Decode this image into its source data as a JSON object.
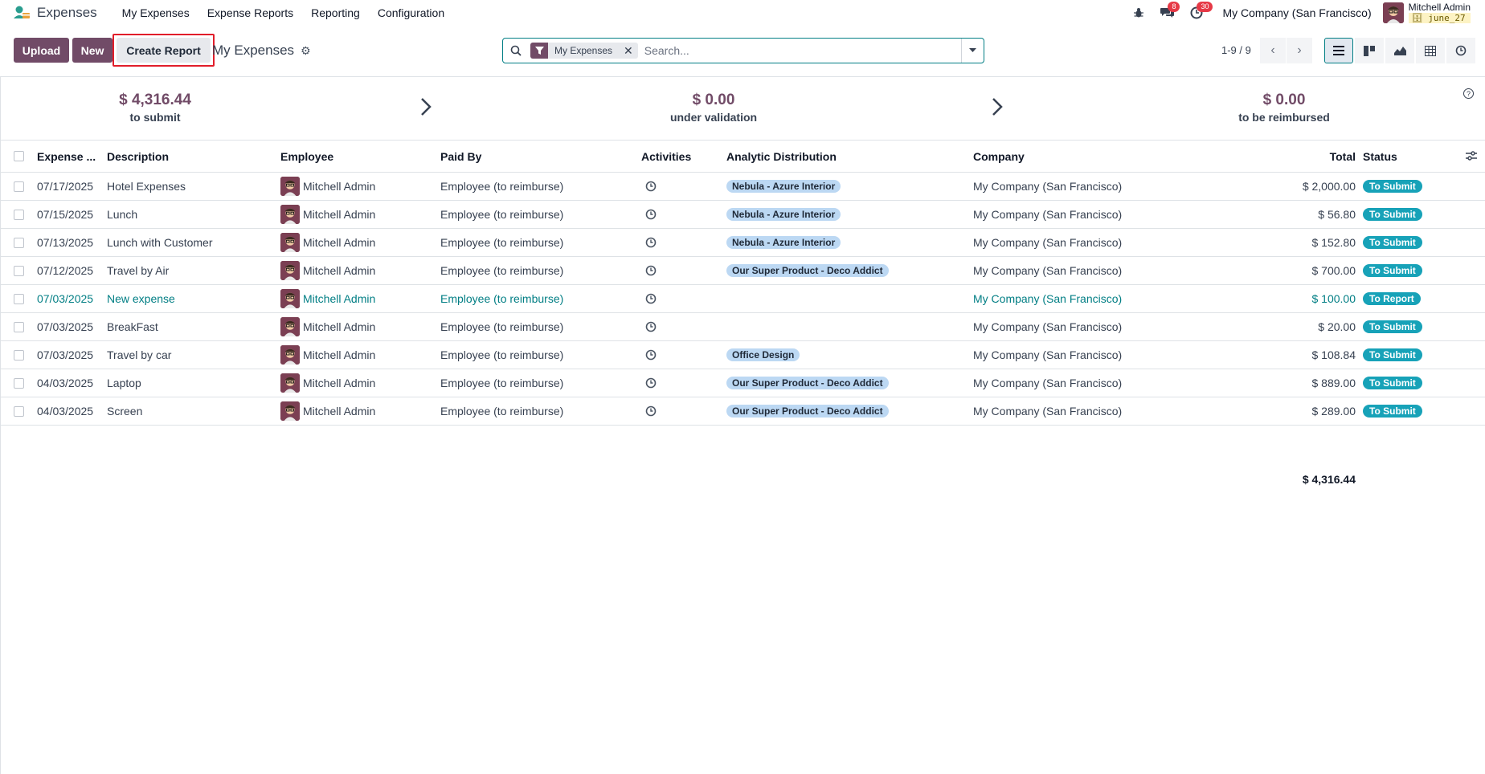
{
  "app": {
    "title": "Expenses",
    "menu": [
      "My Expenses",
      "Expense Reports",
      "Reporting",
      "Configuration"
    ],
    "company": "My Company (San Francisco)",
    "user": "Mitchell Admin",
    "database": "june_27",
    "messages_count": "8",
    "activities_count": "30"
  },
  "toolbar": {
    "upload_label": "Upload",
    "new_label": "New",
    "create_report_label": "Create Report",
    "breadcrumb": "My Expenses"
  },
  "search": {
    "facet": "My Expenses",
    "placeholder": "Search..."
  },
  "pager": {
    "range": "1-9 / 9"
  },
  "stages": [
    {
      "amount": "$ 4,316.44",
      "label": "to submit"
    },
    {
      "amount": "$ 0.00",
      "label": "under validation"
    },
    {
      "amount": "$ 0.00",
      "label": "to be reimbursed"
    }
  ],
  "table": {
    "headers": {
      "date": "Expense ...",
      "description": "Description",
      "employee": "Employee",
      "paid_by": "Paid By",
      "activities": "Activities",
      "analytic": "Analytic Distribution",
      "company": "Company",
      "total": "Total",
      "status": "Status"
    },
    "rows": [
      {
        "date": "07/17/2025",
        "description": "Hotel Expenses",
        "employee": "Mitchell Admin",
        "paid_by": "Employee (to reimburse)",
        "analytic": "Nebula - Azure Interior",
        "company": "My Company (San Francisco)",
        "total": "$ 2,000.00",
        "status": "To Submit"
      },
      {
        "date": "07/15/2025",
        "description": "Lunch",
        "employee": "Mitchell Admin",
        "paid_by": "Employee (to reimburse)",
        "analytic": "Nebula - Azure Interior",
        "company": "My Company (San Francisco)",
        "total": "$ 56.80",
        "status": "To Submit"
      },
      {
        "date": "07/13/2025",
        "description": "Lunch with Customer",
        "employee": "Mitchell Admin",
        "paid_by": "Employee (to reimburse)",
        "analytic": "Nebula - Azure Interior",
        "company": "My Company (San Francisco)",
        "total": "$ 152.80",
        "status": "To Submit"
      },
      {
        "date": "07/12/2025",
        "description": "Travel by Air",
        "employee": "Mitchell Admin",
        "paid_by": "Employee (to reimburse)",
        "analytic": "Our Super Product - Deco Addict",
        "company": "My Company (San Francisco)",
        "total": "$ 700.00",
        "status": "To Submit"
      },
      {
        "date": "07/03/2025",
        "description": "New expense",
        "employee": "Mitchell Admin",
        "paid_by": "Employee (to reimburse)",
        "analytic": "",
        "company": "My Company (San Francisco)",
        "total": "$ 100.00",
        "status": "To Report"
      },
      {
        "date": "07/03/2025",
        "description": "BreakFast",
        "employee": "Mitchell Admin",
        "paid_by": "Employee (to reimburse)",
        "analytic": "",
        "company": "My Company (San Francisco)",
        "total": "$ 20.00",
        "status": "To Submit"
      },
      {
        "date": "07/03/2025",
        "description": "Travel by car",
        "employee": "Mitchell Admin",
        "paid_by": "Employee (to reimburse)",
        "analytic": "Office Design",
        "company": "My Company (San Francisco)",
        "total": "$ 108.84",
        "status": "To Submit"
      },
      {
        "date": "04/03/2025",
        "description": "Laptop",
        "employee": "Mitchell Admin",
        "paid_by": "Employee (to reimburse)",
        "analytic": "Our Super Product - Deco Addict",
        "company": "My Company (San Francisco)",
        "total": "$ 889.00",
        "status": "To Submit"
      },
      {
        "date": "04/03/2025",
        "description": "Screen",
        "employee": "Mitchell Admin",
        "paid_by": "Employee (to reimburse)",
        "analytic": "Our Super Product - Deco Addict",
        "company": "My Company (San Francisco)",
        "total": "$ 289.00",
        "status": "To Submit"
      }
    ],
    "footer_total": "$ 4,316.44"
  },
  "colors": {
    "brand": "#714b67",
    "link": "#017e84",
    "status": "#17a2b8",
    "tag": "#bcd8f3",
    "highlight": "#e11d2a"
  }
}
